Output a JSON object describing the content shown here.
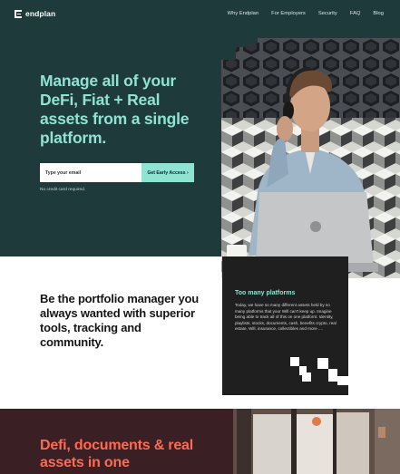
{
  "nav": {
    "brand": "endplan",
    "links": [
      "Why Endplan",
      "For Employers",
      "Security",
      "FAQ",
      "Blog"
    ]
  },
  "hero": {
    "headline": "Manage all of your DeFi, Fiat + Real assets from a single platform.",
    "email_placeholder": "Type your email",
    "cta_label": "Get Early Access ›",
    "note": "No credit card required."
  },
  "section2": {
    "title": "Be the portfolio manager you always wanted with superior tools, tracking and community.",
    "card_title": "Too many platforms",
    "card_body": "Today, we have so many different assets held by so many platforms that your Will can't keep up. Imagine being able to track all of this on one platform: Identity, playlists, stocks, documents, cash, benefits crypto, real estate, Will, insurance, collectibles and more ...."
  },
  "section3": {
    "title": "Defi, documents & real assets in one"
  },
  "colors": {
    "hero_bg": "#1e3a3b",
    "accent_mint": "#8fe3d2",
    "card_bg": "#1f1f1f",
    "section3_bg": "#3a1f24",
    "accent_coral": "#ff6b52"
  }
}
